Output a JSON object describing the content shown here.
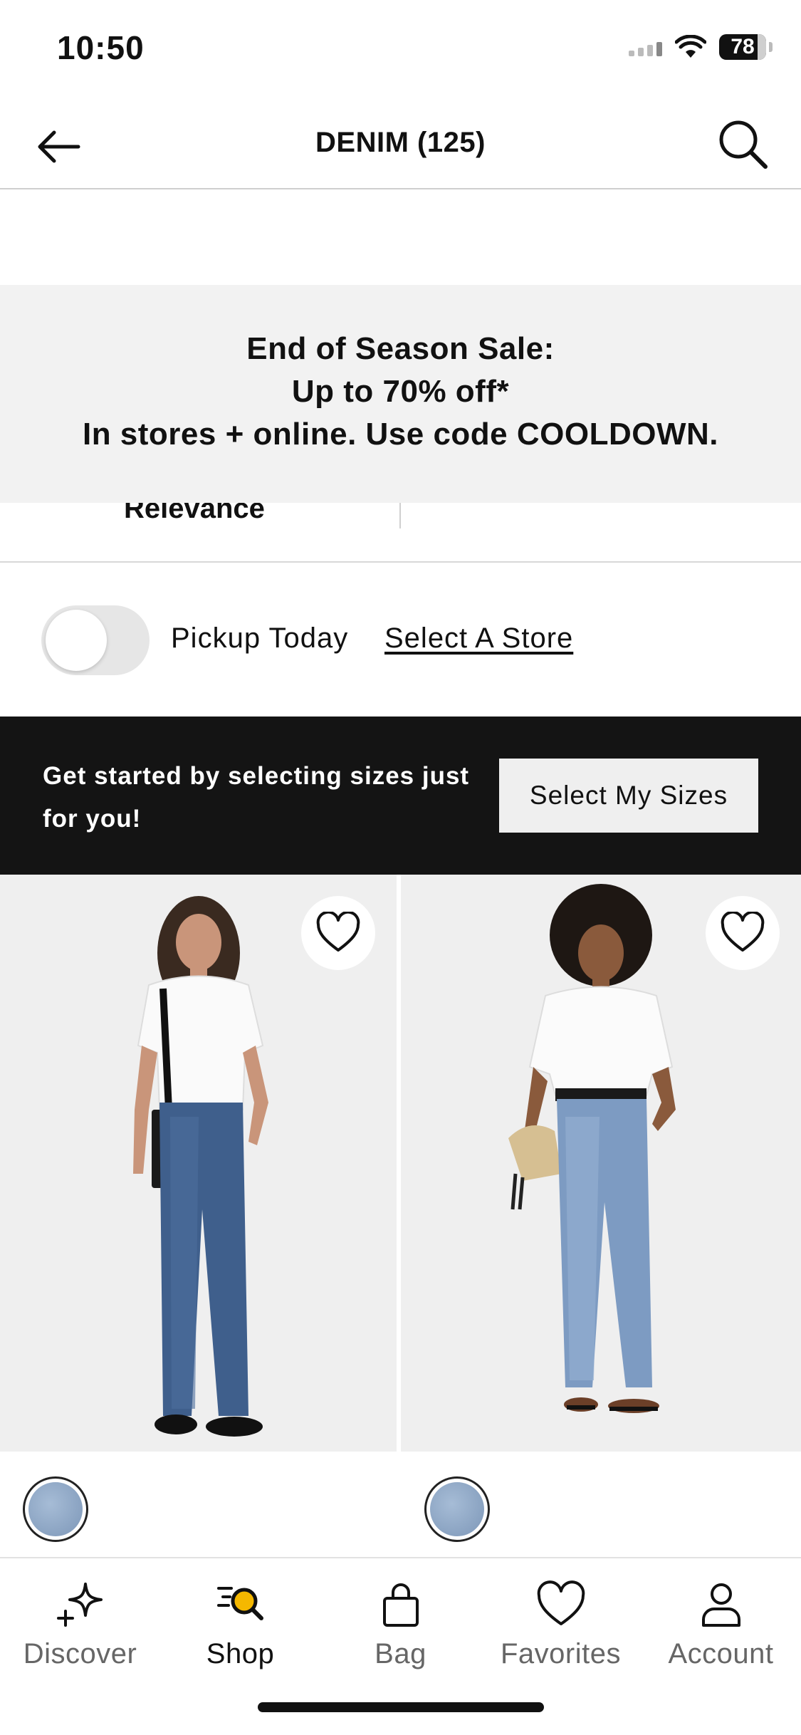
{
  "status_bar": {
    "time": "10:50",
    "battery": "78"
  },
  "header": {
    "title": "DENIM (125)"
  },
  "promo": {
    "line1": "End of Season Sale:",
    "line2": "Up to 70% off*",
    "line3": "In stores + online. Use code COOLDOWN."
  },
  "sort": {
    "label": "Relevance"
  },
  "pickup": {
    "label": "Pickup Today",
    "store_link": "Select A Store",
    "enabled": false
  },
  "sizes_banner": {
    "text": "Get started by selecting sizes just for you!",
    "button": "Select My Sizes"
  },
  "products": [
    {
      "image": "model-white-tee-dark-wash-barrel-jeans",
      "swatch_color": "#8fa8c6"
    },
    {
      "image": "model-white-shirt-light-wash-barrel-jeans",
      "swatch_color": "#8fa8c6"
    }
  ],
  "tabs": [
    {
      "label": "Discover",
      "icon": "sparkle-icon",
      "active": false
    },
    {
      "label": "Shop",
      "icon": "shop-search-icon",
      "active": true
    },
    {
      "label": "Bag",
      "icon": "bag-icon",
      "active": false
    },
    {
      "label": "Favorites",
      "icon": "heart-icon",
      "active": false
    },
    {
      "label": "Account",
      "icon": "person-icon",
      "active": false
    }
  ],
  "colors": {
    "accent": "#f5b800",
    "dark_banner": "#141414",
    "promo_bg": "#f2f2f2"
  }
}
